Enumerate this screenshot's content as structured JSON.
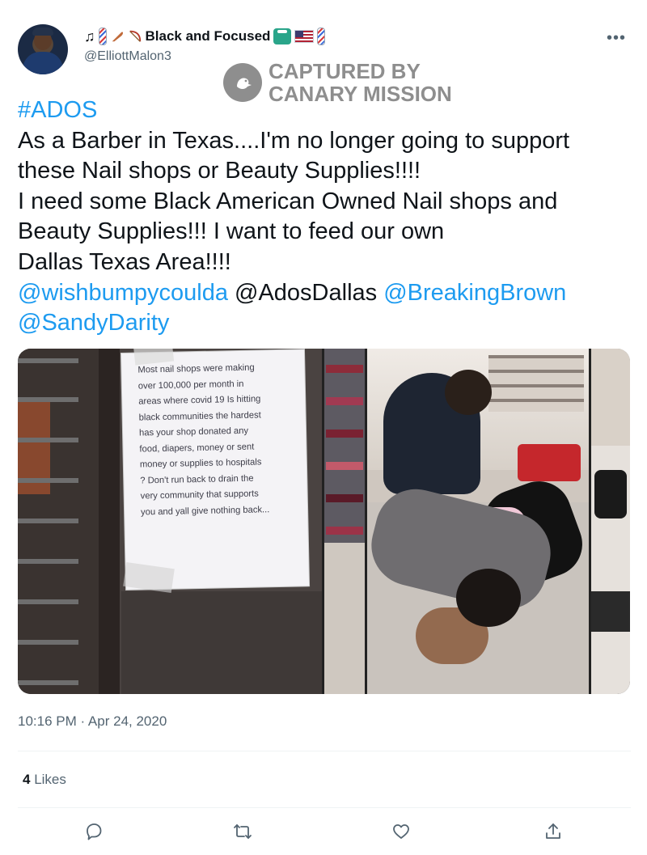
{
  "header": {
    "display_name": "Black and Focused",
    "handle": "@ElliottMalon3",
    "more_label": "•••"
  },
  "watermark": {
    "line1": "CAPTURED BY",
    "line2": "CANARY MISSION"
  },
  "tweet": {
    "lines": [
      "#ADOS",
      "As a Barber in Texas....I'm no longer going to support",
      "these Nail shops or Beauty Supplies!!!!",
      "I need some Black American Owned Nail shops and",
      "Beauty Supplies!!! I want to feed our own",
      "Dallas Texas Area!!!!"
    ],
    "mention1": "@wishbumpycoulda",
    "mention2": "@AdosDallas",
    "mention3": "@BreakingBrown",
    "mention4": "@SandyDarity"
  },
  "notice": {
    "lines": [
      "Most nail shops were making",
      "over 100,000 per month in",
      "areas where covid 19 Is hitting",
      "black communities the hardest",
      "has your shop donated any",
      "food, diapers, money or sent",
      "money or supplies to hospitals",
      "? Don't run back to drain the",
      "very community that supports",
      "you and yall give nothing back..."
    ]
  },
  "meta": {
    "timestamp": "10:16 PM · Apr 24, 2020",
    "likes_count": "4",
    "likes_label": "Likes"
  },
  "colors": {
    "link": "#1d9bf0",
    "secondary_text": "#536471",
    "watermark": "#8e8e8e"
  },
  "actions": [
    "reply-icon",
    "retweet-icon",
    "like-icon",
    "share-icon"
  ]
}
